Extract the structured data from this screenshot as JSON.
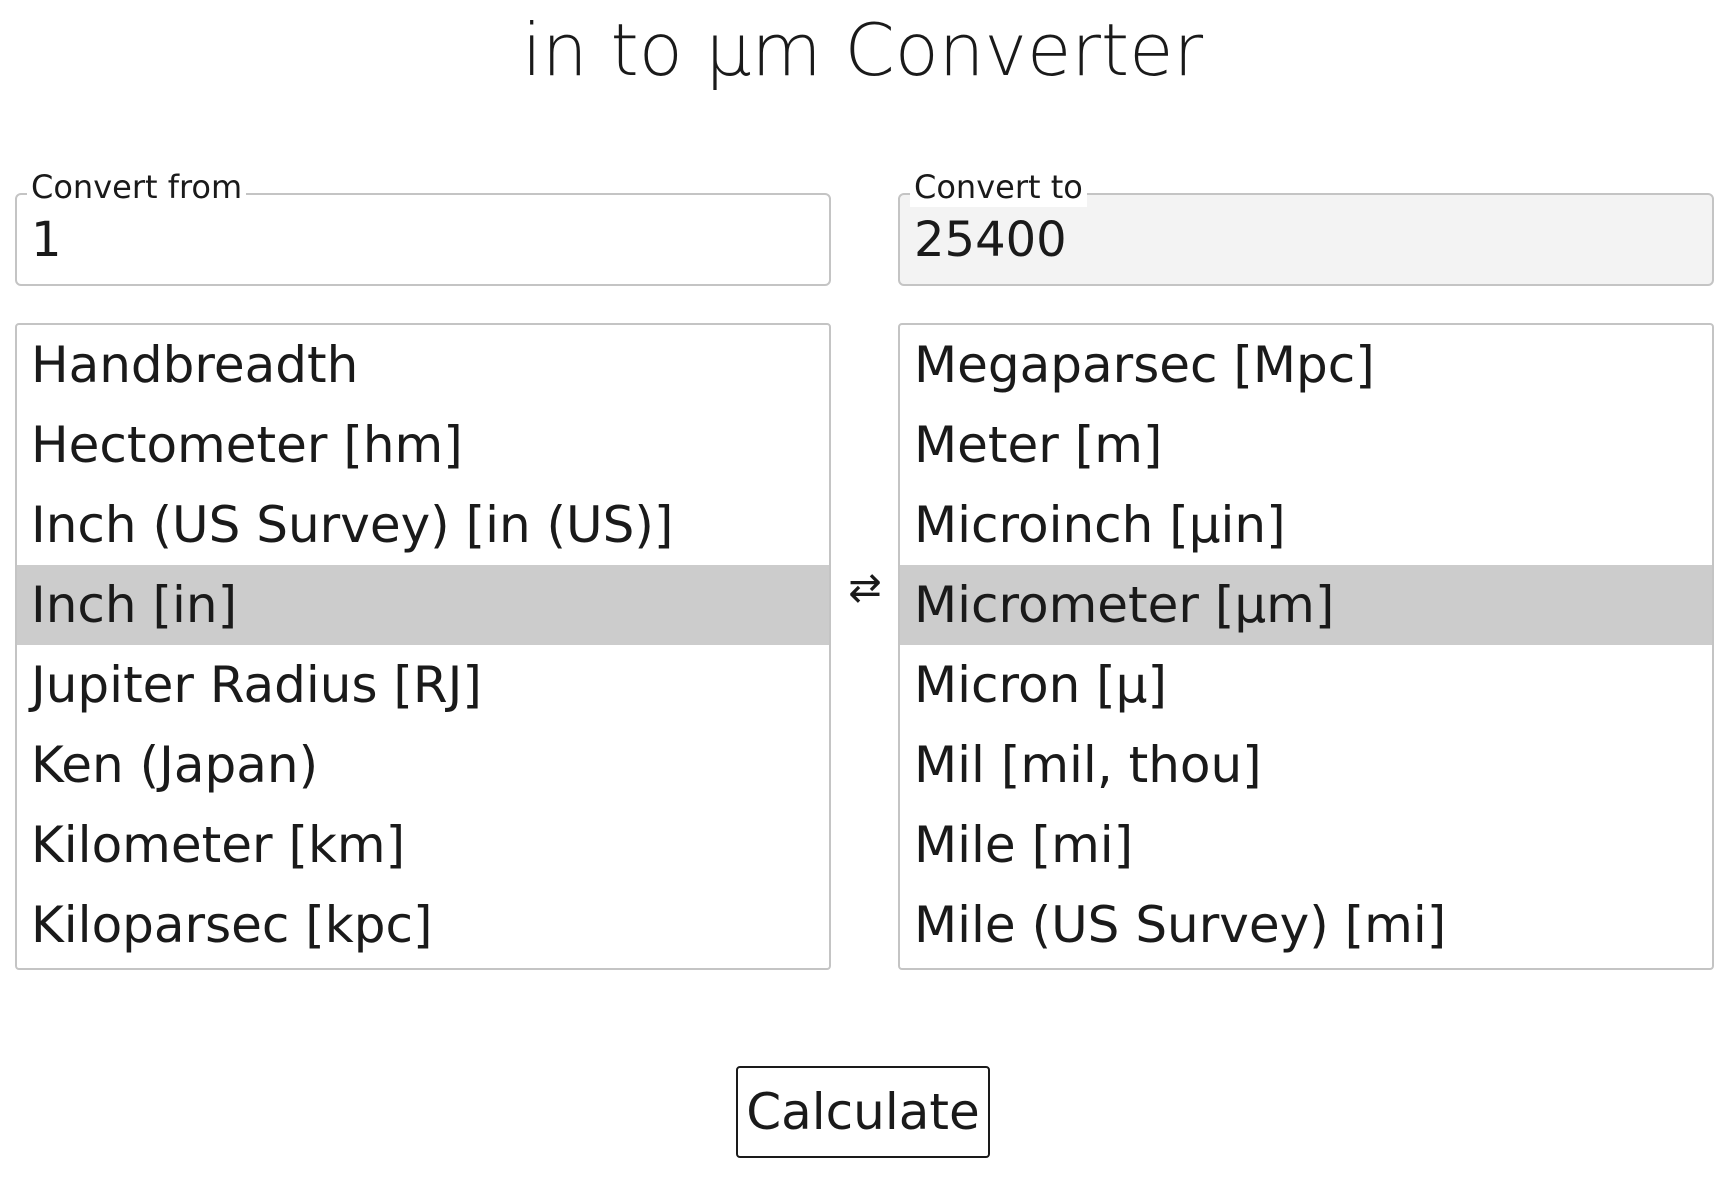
{
  "title": "in to µm Converter",
  "from": {
    "legend": "Convert from",
    "value": "1",
    "units": [
      "Handbreadth",
      "Hectometer [hm]",
      "Inch (US Survey) [in (US)]",
      "Inch [in]",
      "Jupiter Radius [RJ]",
      "Ken (Japan)",
      "Kilometer [km]",
      "Kiloparsec [kpc]"
    ],
    "selected": "Inch [in]"
  },
  "to": {
    "legend": "Convert to",
    "value": "25400",
    "units": [
      "Megaparsec [Mpc]",
      "Meter [m]",
      "Microinch [µin]",
      "Micrometer [µm]",
      "Micron [µ]",
      "Mil [mil, thou]",
      "Mile [mi]",
      "Mile (US Survey) [mi]"
    ],
    "selected": "Micrometer [µm]"
  },
  "swap": {
    "icon": "swap-arrows-icon",
    "glyph": "⇄"
  },
  "calculate_label": "Calculate",
  "colors": {
    "selected_bg": "#cccccc",
    "readonly_bg": "#f3f3f3",
    "border": "#c4c4c4",
    "text": "#1a1a1a"
  }
}
